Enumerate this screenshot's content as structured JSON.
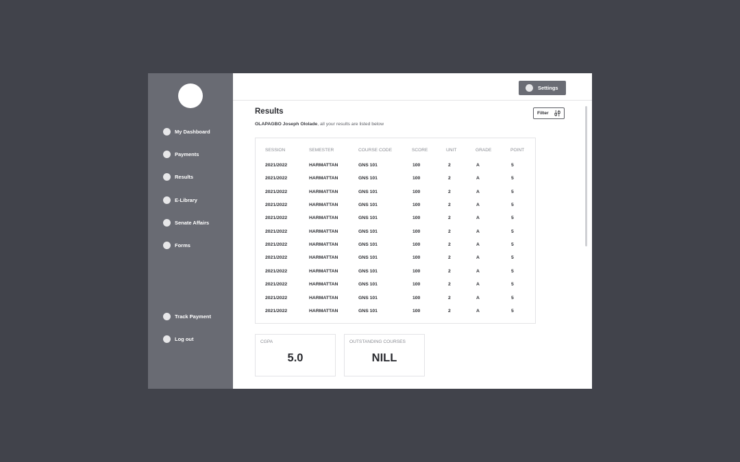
{
  "sidebar": {
    "items": [
      {
        "label": "My Dashboard"
      },
      {
        "label": "Payments"
      },
      {
        "label": "Results"
      },
      {
        "label": "E-Library"
      },
      {
        "label": "Senate Affairs"
      },
      {
        "label": "Forms"
      }
    ],
    "bottom_items": [
      {
        "label": "Track Payment"
      },
      {
        "label": "Log out"
      }
    ]
  },
  "header": {
    "settings_label": "Settings"
  },
  "main": {
    "title": "Results",
    "student_name": "OLAPAGBO Joseph Ololade",
    "subtitle_rest": ", all your results are listed below",
    "filter_label": "Filter"
  },
  "table": {
    "headers": [
      "SESSION",
      "SEMESTER",
      "COURSE CODE",
      "SCORE",
      "UNIT",
      "GRADE",
      "POINT"
    ],
    "rows": [
      [
        "2021/2022",
        "HARMATTAN",
        "GNS 101",
        "100",
        "2",
        "A",
        "5"
      ],
      [
        "2021/2022",
        "HARMATTAN",
        "GNS 101",
        "100",
        "2",
        "A",
        "5"
      ],
      [
        "2021/2022",
        "HARMATTAN",
        "GNS 101",
        "100",
        "2",
        "A",
        "5"
      ],
      [
        "2021/2022",
        "HARMATTAN",
        "GNS 101",
        "100",
        "2",
        "A",
        "5"
      ],
      [
        "2021/2022",
        "HARMATTAN",
        "GNS 101",
        "100",
        "2",
        "A",
        "5"
      ],
      [
        "2021/2022",
        "HARMATTAN",
        "GNS 101",
        "100",
        "2",
        "A",
        "5"
      ],
      [
        "2021/2022",
        "HARMATTAN",
        "GNS 101",
        "100",
        "2",
        "A",
        "5"
      ],
      [
        "2021/2022",
        "HARMATTAN",
        "GNS 101",
        "100",
        "2",
        "A",
        "5"
      ],
      [
        "2021/2022",
        "HARMATTAN",
        "GNS 101",
        "100",
        "2",
        "A",
        "5"
      ],
      [
        "2021/2022",
        "HARMATTAN",
        "GNS 101",
        "100",
        "2",
        "A",
        "5"
      ],
      [
        "2021/2022",
        "HARMATTAN",
        "GNS 101",
        "100",
        "2",
        "A",
        "5"
      ],
      [
        "2021/2022",
        "HARMATTAN",
        "GNS 101",
        "100",
        "2",
        "A",
        "5"
      ]
    ]
  },
  "stats": {
    "cgpa": {
      "label": "CGPA",
      "value": "5.0"
    },
    "outstanding": {
      "label": "OUTSTANDING COURSES",
      "value": "NILL"
    }
  },
  "icons": {
    "nav": "circle-icon",
    "settings": "circle-icon",
    "filter": "sliders-icon"
  },
  "colors": {
    "background": "#41434b",
    "sidebar": "#696b73",
    "button": "#6a6c74",
    "text": "#2a2b30"
  }
}
